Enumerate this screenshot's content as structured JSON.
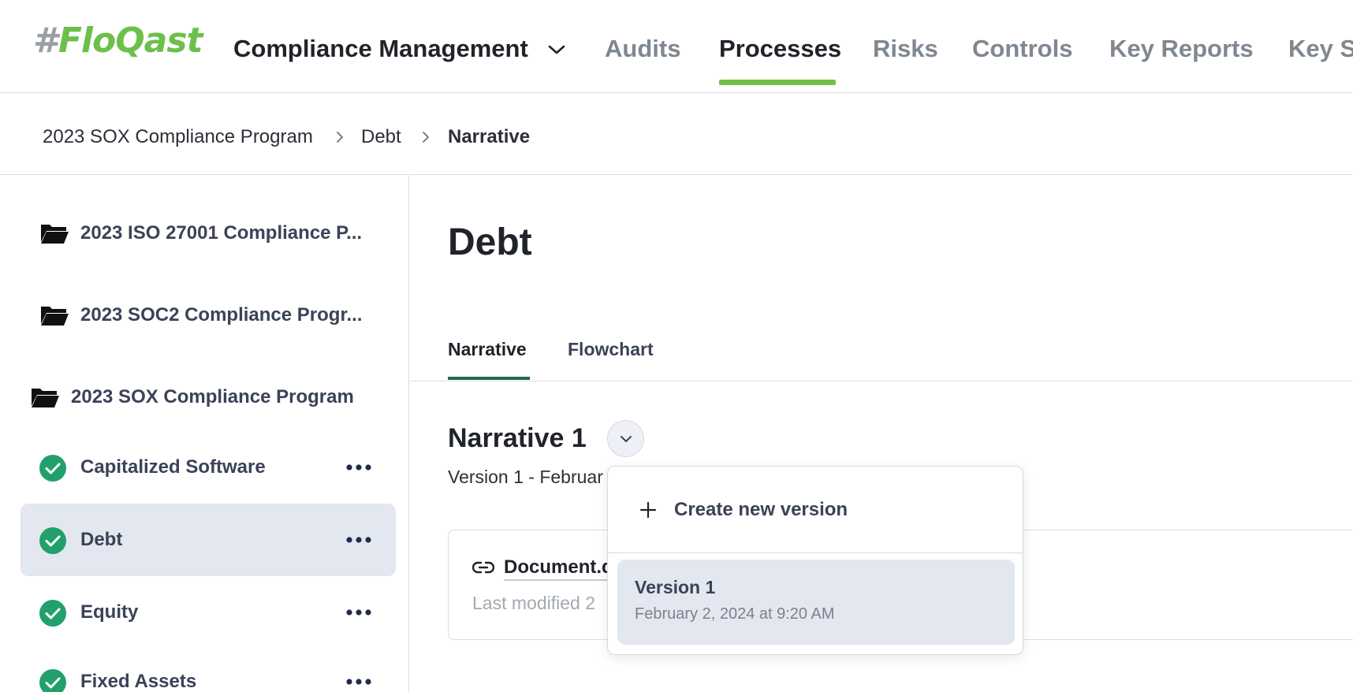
{
  "app": {
    "logo_hash": "#",
    "logo_name": "FloQast",
    "brand_color": "#6cc04a"
  },
  "nav": {
    "module": "Compliance Management",
    "items": [
      "Audits",
      "Processes",
      "Risks",
      "Controls",
      "Key Reports",
      "Key Sy"
    ],
    "active": "Processes"
  },
  "breadcrumb": {
    "items": [
      "2023 SOX Compliance Program",
      "Debt",
      "Narrative"
    ]
  },
  "sidebar": {
    "programs": [
      "2023 ISO 27001 Compliance P...",
      "2023 SOC2 Compliance Progr...",
      "2023 SOX Compliance Program"
    ],
    "processes": [
      {
        "label": "Capitalized Software",
        "status": "complete"
      },
      {
        "label": "Debt",
        "status": "complete",
        "selected": true
      },
      {
        "label": "Equity",
        "status": "complete"
      },
      {
        "label": "Fixed Assets",
        "status": "complete"
      }
    ],
    "status_color": "#22a06b"
  },
  "main": {
    "title": "Debt",
    "tabs": [
      "Narrative",
      "Flowchart"
    ],
    "active_tab": "Narrative",
    "narrative_title": "Narrative 1",
    "version_line": "Version 1 - Februar",
    "document": {
      "link_label": "Document.d",
      "meta": "Last modified 2"
    }
  },
  "dropdown": {
    "create_label": "Create new version",
    "versions": [
      {
        "title": "Version 1",
        "date": "February 2, 2024 at 9:20 AM"
      }
    ]
  }
}
